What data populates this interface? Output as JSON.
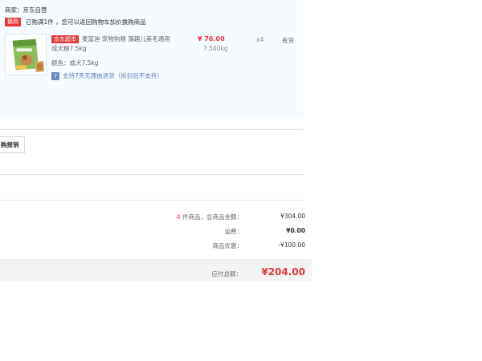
{
  "shop": {
    "seller": "商家：京东自营"
  },
  "promo": {
    "tag": "换购",
    "text": "已购满1件 ，您可以返回购物车加价换购商品"
  },
  "product": {
    "store_tag": "京东超市",
    "name": "麦富迪 宠物狗粮 藻趣儿美毛通用成犬粮7.5kg",
    "color": "颜色：成犬7.5kg",
    "return_icon": "7",
    "return_policy": "支持7天无理由退货（拆封后不支持）",
    "price": "¥ 76.00",
    "weight": "7.500kg",
    "qty": "x4",
    "stock": "有货"
  },
  "invoice": {
    "button_label": "购报销"
  },
  "summary": {
    "count": "4",
    "count_suffix": " 件商品，总商品金额：",
    "goods_total": "¥304.00",
    "shipping_label": "运费：",
    "shipping_value": "¥0.00",
    "discount_label": "商品优惠：",
    "discount_value": "-¥100.00",
    "payable_label": "应付总额：",
    "payable_value": "¥204.00"
  },
  "colors": {
    "accent_red": "#e4393c",
    "panel_bg": "#f5fbff",
    "link_blue": "#5c7ab8"
  }
}
